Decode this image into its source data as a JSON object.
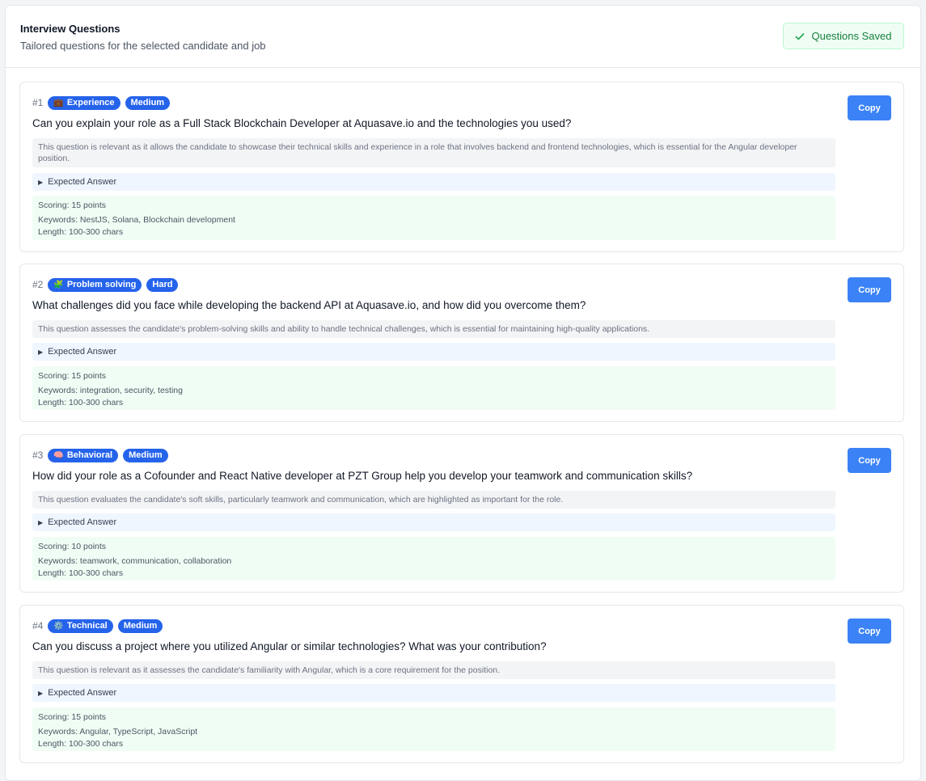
{
  "header": {
    "title": "Interview Questions",
    "subtitle": "Tailored questions for the selected candidate and job",
    "saved_label": "Questions Saved"
  },
  "colors": {
    "accent": "#2563eb",
    "button": "#3b82f6",
    "success": "#15803d"
  },
  "questions": [
    {
      "number": "#1",
      "category": "Experience",
      "category_icon": "💼",
      "difficulty": "Medium",
      "text": "Can you explain your role as a Full Stack Blockchain Developer at Aquasave.io and the technologies you used?",
      "rationale": "This question is relevant as it allows the candidate to showcase their technical skills and experience in a role that involves backend and frontend technologies, which is essential for the Angular developer position.",
      "expected_label": "Expected Answer",
      "scoring": "Scoring: 15 points",
      "keywords": "Keywords: NestJS, Solana, Blockchain development",
      "length": "Length: 100-300 chars",
      "copy_label": "Copy"
    },
    {
      "number": "#2",
      "category": "Problem solving",
      "category_icon": "🧩",
      "difficulty": "Hard",
      "text": "What challenges did you face while developing the backend API at Aquasave.io, and how did you overcome them?",
      "rationale": "This question assesses the candidate's problem-solving skills and ability to handle technical challenges, which is essential for maintaining high-quality applications.",
      "expected_label": "Expected Answer",
      "scoring": "Scoring: 15 points",
      "keywords": "Keywords: integration, security, testing",
      "length": "Length: 100-300 chars",
      "copy_label": "Copy"
    },
    {
      "number": "#3",
      "category": "Behavioral",
      "category_icon": "🧠",
      "difficulty": "Medium",
      "text": "How did your role as a Cofounder and React Native developer at PZT Group help you develop your teamwork and communication skills?",
      "rationale": "This question evaluates the candidate's soft skills, particularly teamwork and communication, which are highlighted as important for the role.",
      "expected_label": "Expected Answer",
      "scoring": "Scoring: 10 points",
      "keywords": "Keywords: teamwork, communication, collaboration",
      "length": "Length: 100-300 chars",
      "copy_label": "Copy"
    },
    {
      "number": "#4",
      "category": "Technical",
      "category_icon": "⚙️",
      "difficulty": "Medium",
      "text": "Can you discuss a project where you utilized Angular or similar technologies? What was your contribution?",
      "rationale": "This question is relevant as it assesses the candidate's familiarity with Angular, which is a core requirement for the position.",
      "expected_label": "Expected Answer",
      "scoring": "Scoring: 15 points",
      "keywords": "Keywords: Angular, TypeScript, JavaScript",
      "length": "Length: 100-300 chars",
      "copy_label": "Copy"
    }
  ]
}
